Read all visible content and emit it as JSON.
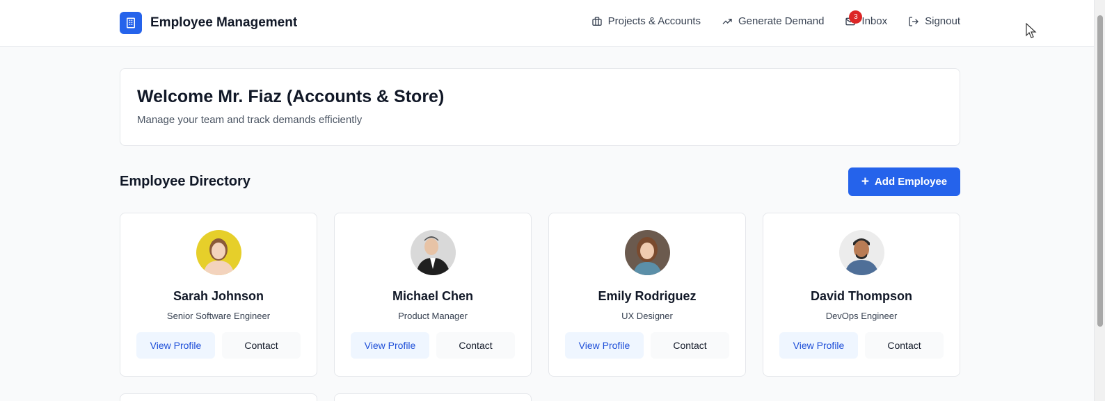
{
  "app": {
    "title": "Employee Management"
  },
  "nav": {
    "items": [
      {
        "label": "Projects & Accounts",
        "icon": "briefcase-icon"
      },
      {
        "label": "Generate Demand",
        "icon": "trending-up-icon"
      },
      {
        "label": "Inbox",
        "icon": "mail-icon",
        "badge": "3"
      },
      {
        "label": "Signout",
        "icon": "logout-icon"
      }
    ]
  },
  "welcome": {
    "title": "Welcome Mr. Fiaz (Accounts & Store)",
    "subtitle": "Manage your team and track demands efficiently"
  },
  "directory": {
    "title": "Employee Directory",
    "add_button": "Add Employee",
    "view_label": "View Profile",
    "contact_label": "Contact",
    "employees": [
      {
        "name": "Sarah Johnson",
        "role": "Senior Software Engineer"
      },
      {
        "name": "Michael Chen",
        "role": "Product Manager"
      },
      {
        "name": "Emily Rodriguez",
        "role": "UX Designer"
      },
      {
        "name": "David Thompson",
        "role": "DevOps Engineer"
      }
    ]
  },
  "colors": {
    "primary": "#2563eb",
    "badge": "#dc2626",
    "view_bg": "#eff6ff"
  }
}
